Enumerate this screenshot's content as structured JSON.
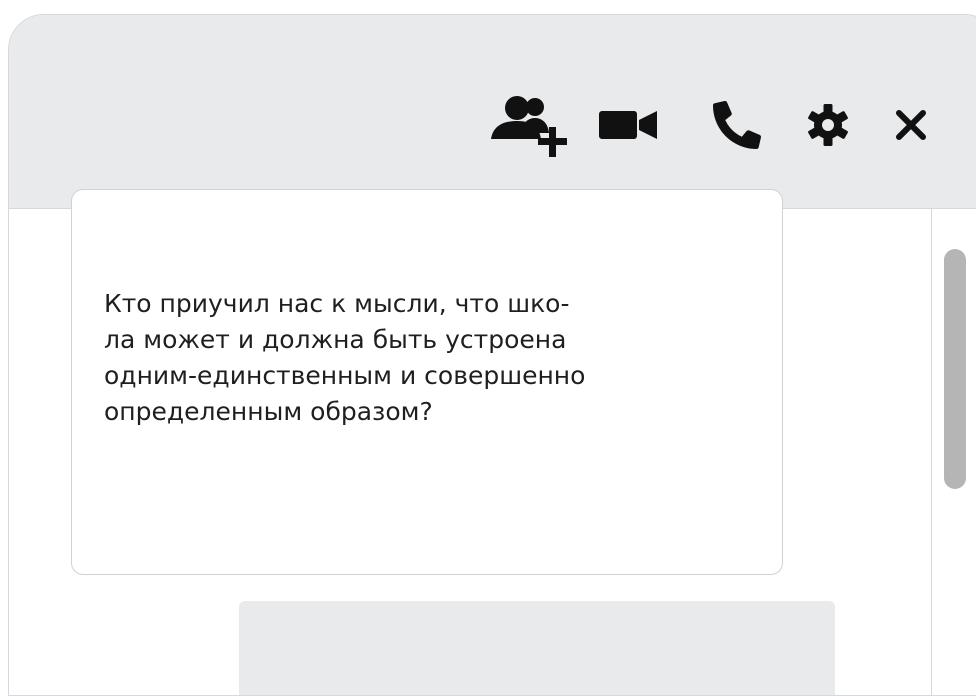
{
  "header": {
    "actions": [
      {
        "id": "add-participant",
        "icon": "add-user-icon"
      },
      {
        "id": "video-call",
        "icon": "video-camera-icon"
      },
      {
        "id": "voice-call",
        "icon": "phone-icon"
      },
      {
        "id": "settings",
        "icon": "gear-icon"
      },
      {
        "id": "close",
        "icon": "close-icon"
      }
    ],
    "icon_color": "#111111"
  },
  "messages": [
    {
      "text": "Кто приучил нас к мысли, что шко-\nла может и должна быть устроена\nодним-единственным и совершенно\nопределенным образом?"
    }
  ],
  "colors": {
    "header_background": "#e9eaec",
    "bubble_border": "#cfd2d6",
    "reply_bubble_background": "#e9eaec",
    "scrollbar_thumb": "#b5b5b5"
  }
}
